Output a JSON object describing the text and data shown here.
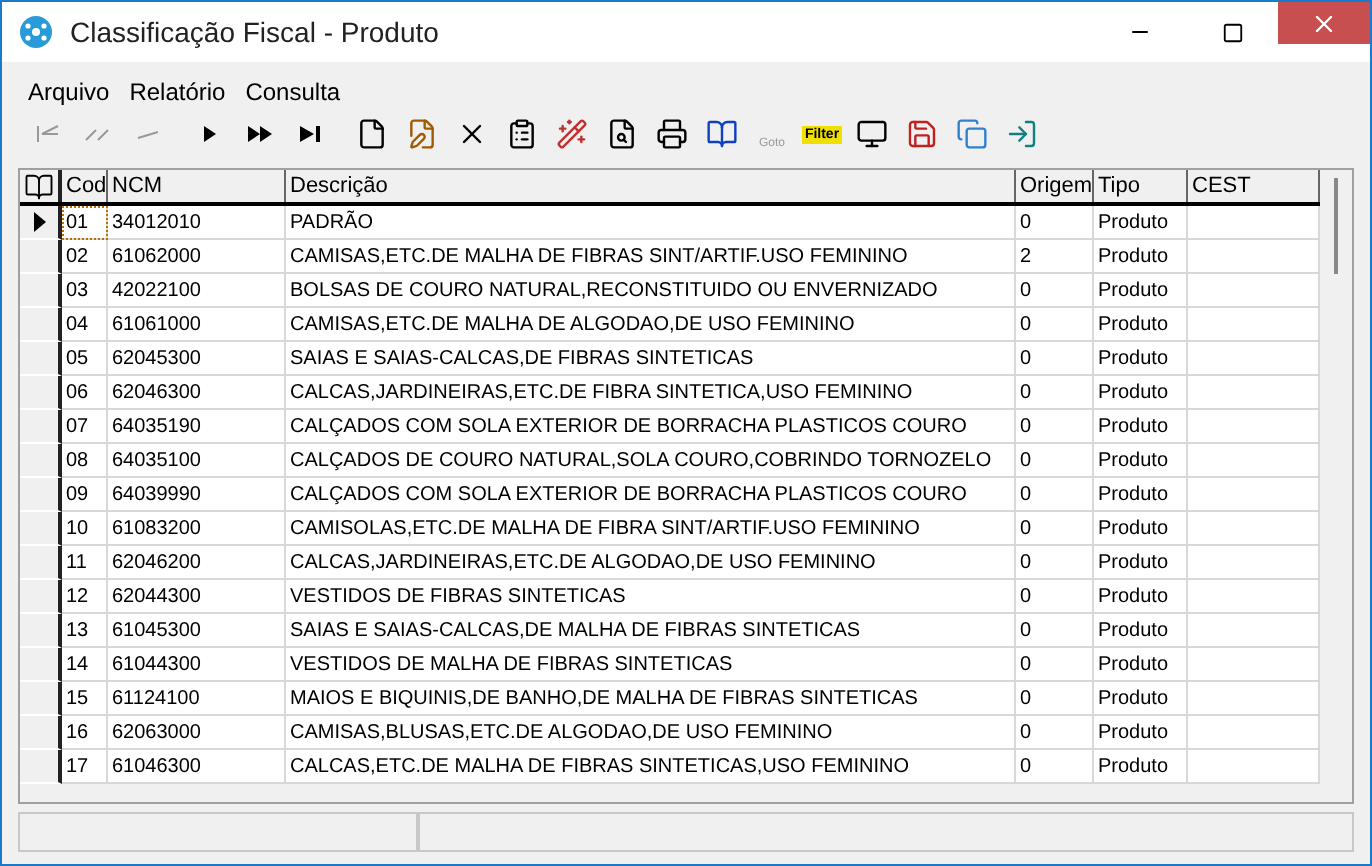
{
  "window": {
    "title": "Classificação Fiscal - Produto"
  },
  "menu": [
    "Arquivo",
    "Relatório",
    "Consulta"
  ],
  "toolbar": [
    {
      "kind": "first",
      "disabled": true
    },
    {
      "kind": "prior",
      "disabled": true
    },
    {
      "kind": "previous",
      "disabled": true
    },
    {
      "kind": "next",
      "disabled": false
    },
    {
      "kind": "forward",
      "disabled": false
    },
    {
      "kind": "last",
      "disabled": false
    },
    {
      "kind": "new",
      "disabled": false
    },
    {
      "kind": "edit",
      "disabled": false
    },
    {
      "kind": "delete",
      "disabled": false
    },
    {
      "kind": "properties",
      "disabled": false
    },
    {
      "kind": "wand",
      "disabled": false
    },
    {
      "kind": "preview",
      "disabled": false
    },
    {
      "kind": "print",
      "disabled": false
    },
    {
      "kind": "book",
      "disabled": false
    },
    {
      "kind": "goto",
      "disabled": true,
      "label": "Goto"
    },
    {
      "kind": "filter",
      "disabled": false,
      "label": "Filter"
    },
    {
      "kind": "screen",
      "disabled": false
    },
    {
      "kind": "save",
      "disabled": false
    },
    {
      "kind": "windows",
      "disabled": false
    },
    {
      "kind": "exit",
      "disabled": false
    }
  ],
  "table": {
    "columns": [
      "Cod",
      "NCM",
      "Descrição",
      "Origem",
      "Tipo",
      "CEST"
    ],
    "rows": [
      {
        "selected": true,
        "cells": [
          "01",
          "34012010",
          "PADRÃO",
          "0",
          "Produto"
        ]
      },
      {
        "selected": false,
        "cells": [
          "02",
          "61062000",
          "CAMISAS,ETC.DE MALHA DE FIBRAS SINT/ARTIF.USO FEMININO",
          "2",
          "Produto"
        ]
      },
      {
        "selected": false,
        "cells": [
          "03",
          "42022100",
          "BOLSAS DE COURO NATURAL,RECONSTITUIDO OU ENVERNIZADO",
          "0",
          "Produto"
        ]
      },
      {
        "selected": false,
        "cells": [
          "04",
          "61061000",
          "CAMISAS,ETC.DE MALHA DE ALGODAO,DE USO FEMININO",
          "0",
          "Produto"
        ]
      },
      {
        "selected": false,
        "cells": [
          "05",
          "62045300",
          "SAIAS E SAIAS-CALCAS,DE FIBRAS SINTETICAS",
          "0",
          "Produto"
        ]
      },
      {
        "selected": false,
        "cells": [
          "06",
          "62046300",
          "CALCAS,JARDINEIRAS,ETC.DE FIBRA SINTETICA,USO FEMININO",
          "0",
          "Produto"
        ]
      },
      {
        "selected": false,
        "cells": [
          "07",
          "64035190",
          "CALÇADOS COM SOLA EXTERIOR DE BORRACHA PLASTICOS COURO",
          "0",
          "Produto"
        ]
      },
      {
        "selected": false,
        "cells": [
          "08",
          "64035100",
          "CALÇADOS DE COURO NATURAL,SOLA COURO,COBRINDO TORNOZELO",
          "0",
          "Produto"
        ]
      },
      {
        "selected": false,
        "cells": [
          "09",
          "64039990",
          "CALÇADOS COM SOLA EXTERIOR DE BORRACHA PLASTICOS COURO",
          "0",
          "Produto"
        ]
      },
      {
        "selected": false,
        "cells": [
          "10",
          "61083200",
          "CAMISOLAS,ETC.DE MALHA DE FIBRA SINT/ARTIF.USO FEMININO",
          "0",
          "Produto"
        ]
      },
      {
        "selected": false,
        "cells": [
          "11",
          "62046200",
          "CALCAS,JARDINEIRAS,ETC.DE ALGODAO,DE USO FEMININO",
          "0",
          "Produto"
        ]
      },
      {
        "selected": false,
        "cells": [
          "12",
          "62044300",
          "VESTIDOS DE FIBRAS SINTETICAS",
          "0",
          "Produto"
        ]
      },
      {
        "selected": false,
        "cells": [
          "13",
          "61045300",
          "SAIAS E SAIAS-CALCAS,DE MALHA DE FIBRAS SINTETICAS",
          "0",
          "Produto"
        ]
      },
      {
        "selected": false,
        "cells": [
          "14",
          "61044300",
          "VESTIDOS DE MALHA DE FIBRAS SINTETICAS",
          "0",
          "Produto"
        ]
      },
      {
        "selected": false,
        "cells": [
          "15",
          "61124100",
          "MAIOS E BIQUINIS,DE BANHO,DE MALHA DE FIBRAS SINTETICAS",
          "0",
          "Produto"
        ]
      },
      {
        "selected": false,
        "cells": [
          "16",
          "62063000",
          "CAMISAS,BLUSAS,ETC.DE ALGODAO,DE USO FEMININO",
          "0",
          "Produto"
        ]
      },
      {
        "selected": false,
        "cells": [
          "17",
          "61046300",
          "CALCAS,ETC.DE MALHA DE FIBRAS SINTETICAS,USO FEMININO",
          "0",
          "Produto"
        ]
      }
    ]
  }
}
